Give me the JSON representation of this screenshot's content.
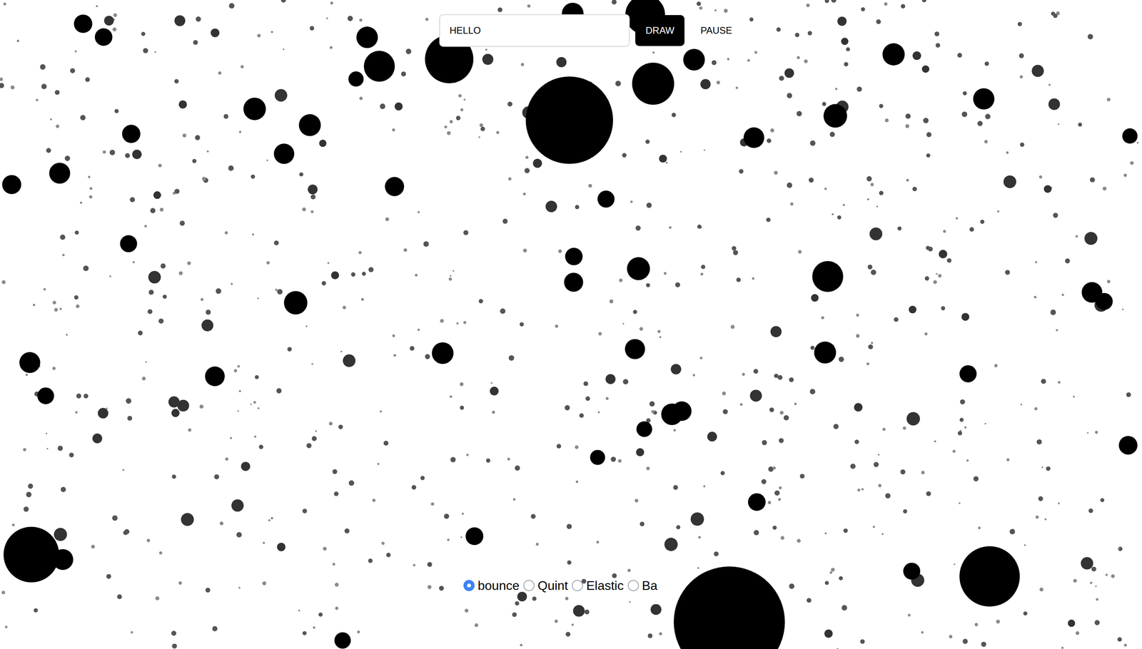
{
  "input": {
    "value": "HELLO"
  },
  "buttons": [
    {
      "label": "DRAW",
      "kind": "primary"
    },
    {
      "label": "PAUSE",
      "kind": "plain"
    }
  ],
  "easing": [
    {
      "label": "bounce",
      "selected": true
    },
    {
      "label": "Quint",
      "selected": false
    },
    {
      "label": "Elastic",
      "selected": false
    },
    {
      "label": "Ba",
      "selected": false
    }
  ]
}
